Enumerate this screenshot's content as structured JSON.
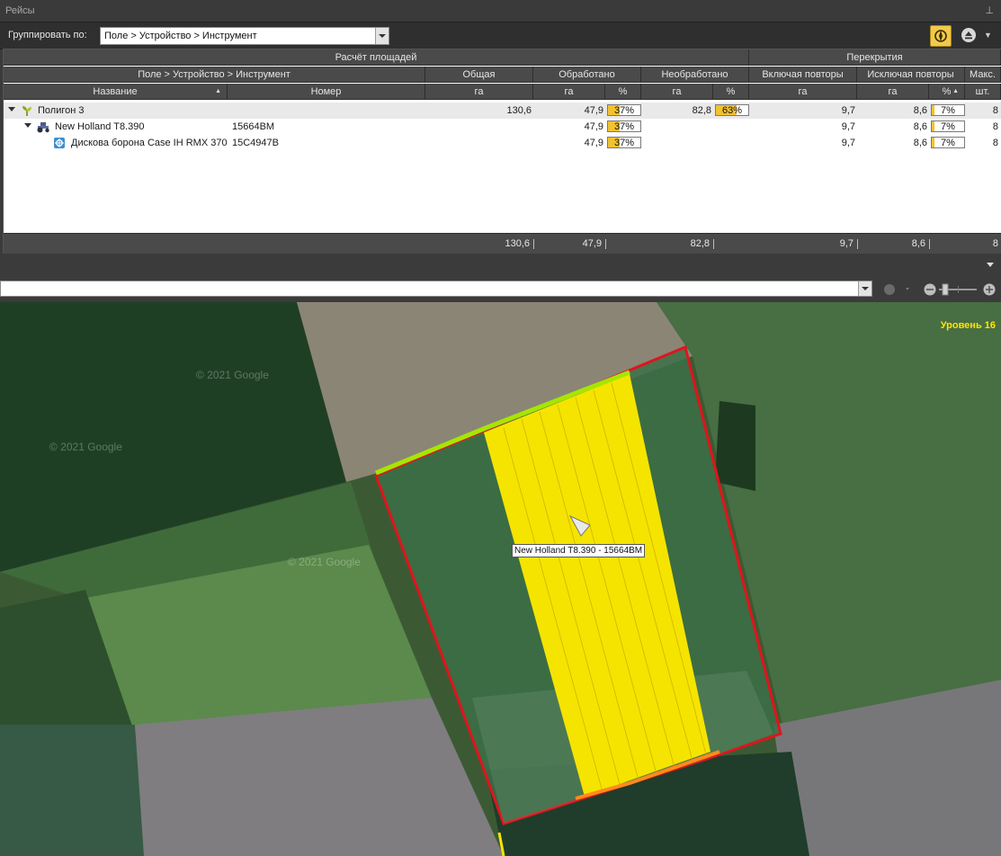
{
  "panel": {
    "title": "Рейсы",
    "pin_glyph": "⊓"
  },
  "toolbar": {
    "group_label": "Группировать по:",
    "group_value": "Поле > Устройство > Инструмент"
  },
  "table": {
    "group_headers": {
      "area_calc": "Расчёт площадей",
      "overlaps": "Перекрытия"
    },
    "sub_headers": {
      "grouping": "Поле > Устройство > Инструмент",
      "total": "Общая",
      "processed": "Обработано",
      "unprocessed": "Необработано",
      "incl_repeats": "Включая повторы",
      "excl_repeats": "Исключая повторы",
      "max": "Макс."
    },
    "col_headers": {
      "name": "Название",
      "number": "Номер",
      "total_ha": "га",
      "proc_ha": "га",
      "proc_pct": "%",
      "unproc_ha": "га",
      "unproc_pct": "%",
      "incl_ha": "га",
      "excl_ha": "га",
      "excl_pct": "%",
      "max_unit": "шт."
    },
    "rows": [
      {
        "name": "Полигон 3",
        "number": "",
        "total": "130,6",
        "proc_ha": "47,9",
        "proc_pct": "37%",
        "proc_frac": 0.37,
        "unproc_ha": "82,8",
        "unproc_pct": "63%",
        "unproc_frac": 0.63,
        "incl": "9,7",
        "excl": "8,6",
        "excl_pct": "7%",
        "excl_frac": 0.07,
        "max": "8"
      },
      {
        "name": "New Holland T8.390",
        "number": "15664ВМ",
        "total": "",
        "proc_ha": "47,9",
        "proc_pct": "37%",
        "proc_frac": 0.37,
        "unproc_ha": "",
        "unproc_pct": "",
        "unproc_frac": 0,
        "incl": "9,7",
        "excl": "8,6",
        "excl_pct": "7%",
        "excl_frac": 0.07,
        "max": "8"
      },
      {
        "name": "Дискова борона Case IH RMX 370",
        "number": "15С4947В",
        "total": "",
        "proc_ha": "47,9",
        "proc_pct": "37%",
        "proc_frac": 0.37,
        "unproc_ha": "",
        "unproc_pct": "",
        "unproc_frac": 0,
        "incl": "9,7",
        "excl": "8,6",
        "excl_pct": "7%",
        "excl_frac": 0.07,
        "max": "8"
      }
    ],
    "footer": {
      "total": "130,6",
      "proc_ha": "47,9",
      "unproc_ha": "82,8",
      "incl": "9,7",
      "excl": "8,6",
      "max": "8"
    }
  },
  "map": {
    "level_text": "Уровень 16",
    "vehicle_label": "New Holland T8.390 - 15664ВМ",
    "watermark": "© 2021 Google"
  },
  "colors": {
    "accent": "#f2c94c",
    "field_border": "#e0141c",
    "track": "#f5e400"
  }
}
